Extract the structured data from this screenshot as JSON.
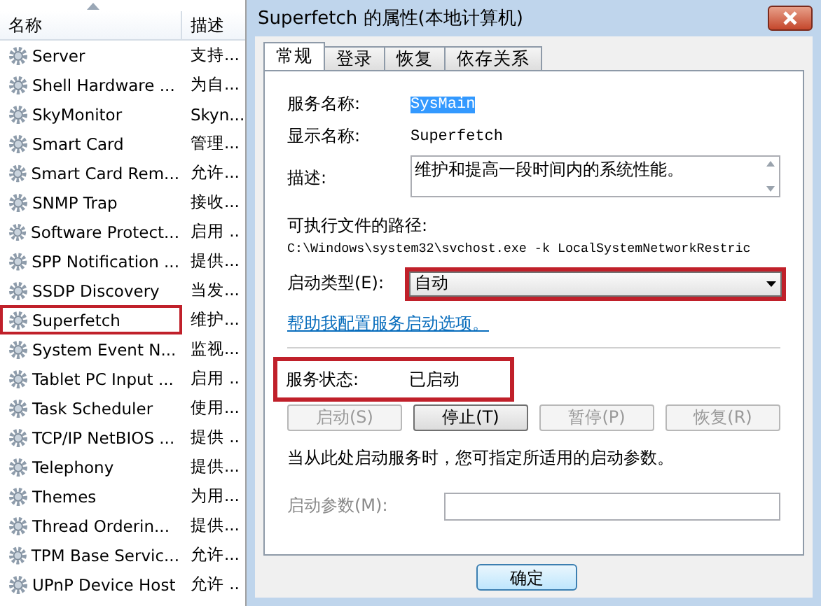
{
  "service_list": {
    "columns": [
      "名称",
      "描述"
    ],
    "rows": [
      {
        "name": "Server",
        "description": "支持...",
        "highlighted": false
      },
      {
        "name": "Shell Hardware ...",
        "description": "为自...",
        "highlighted": false
      },
      {
        "name": "SkyMonitor",
        "description": "Skyn...",
        "highlighted": false
      },
      {
        "name": "Smart Card",
        "description": "管理...",
        "highlighted": false
      },
      {
        "name": "Smart Card Rem...",
        "description": "允许...",
        "highlighted": false
      },
      {
        "name": "SNMP Trap",
        "description": "接收...",
        "highlighted": false
      },
      {
        "name": "Software Protect...",
        "description": "启用 ..",
        "highlighted": false
      },
      {
        "name": "SPP Notification ...",
        "description": "提供...",
        "highlighted": false
      },
      {
        "name": "SSDP Discovery",
        "description": "当发...",
        "highlighted": false
      },
      {
        "name": "Superfetch",
        "description": "维护...",
        "highlighted": true
      },
      {
        "name": "System Event N...",
        "description": "监视...",
        "highlighted": false
      },
      {
        "name": "Tablet PC Input ...",
        "description": "启用 ..",
        "highlighted": false
      },
      {
        "name": "Task Scheduler",
        "description": "使用...",
        "highlighted": false
      },
      {
        "name": "TCP/IP NetBIOS ...",
        "description": "提供 ..",
        "highlighted": false
      },
      {
        "name": "Telephony",
        "description": "提供...",
        "highlighted": false
      },
      {
        "name": "Themes",
        "description": "为用...",
        "highlighted": false
      },
      {
        "name": "Thread Orderin...",
        "description": "提供...",
        "highlighted": false
      },
      {
        "name": "TPM Base Servic...",
        "description": "允许...",
        "highlighted": false
      },
      {
        "name": "UPnP Device Host",
        "description": "允许 ..",
        "highlighted": false
      }
    ]
  },
  "dialog": {
    "title": "Superfetch 的属性(本地计算机)",
    "tabs": [
      {
        "label": "常规",
        "selected": true
      },
      {
        "label": "登录",
        "selected": false
      },
      {
        "label": "恢复",
        "selected": false
      },
      {
        "label": "依存关系",
        "selected": false
      }
    ],
    "service_name": {
      "label": "服务名称:",
      "value": "SysMain"
    },
    "display_name": {
      "label": "显示名称:",
      "value": "Superfetch"
    },
    "description": {
      "label": "描述:",
      "value": "维护和提高一段时间内的系统性能。"
    },
    "path": {
      "label": "可执行文件的路径:",
      "value": "C:\\Windows\\system32\\svchost.exe -k LocalSystemNetworkRestric"
    },
    "startup_type": {
      "label": "启动类型(E):",
      "value": "自动",
      "highlighted": true
    },
    "help_link": "帮助我配置服务启动选项。",
    "service_status": {
      "label": "服务状态:",
      "value": "已启动",
      "highlighted": true
    },
    "control_buttons": [
      {
        "label": "启动(S)",
        "disabled": true
      },
      {
        "label": "停止(T)",
        "disabled": false
      },
      {
        "label": "暂停(P)",
        "disabled": true
      },
      {
        "label": "恢复(R)",
        "disabled": true
      }
    ],
    "hint": "当从此处启动服务时，您可指定所适用的启动参数。",
    "start_parameters": {
      "label": "启动参数(M):",
      "disabled": true
    },
    "buttons": [
      "确定"
    ]
  }
}
